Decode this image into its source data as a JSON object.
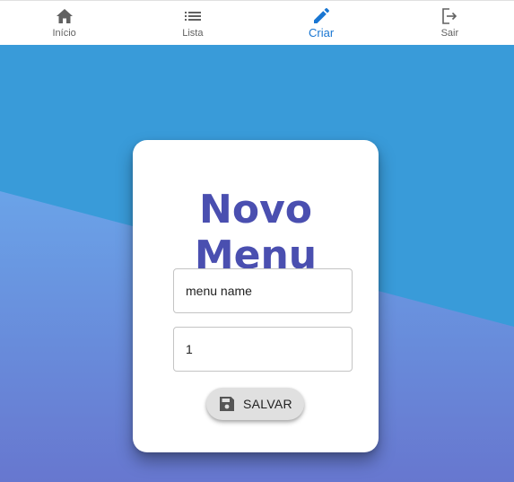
{
  "nav": {
    "items": [
      {
        "label": "Início",
        "icon": "home-icon"
      },
      {
        "label": "Lista",
        "icon": "list-icon"
      },
      {
        "label": "Criar",
        "icon": "pencil-icon",
        "active": true
      },
      {
        "label": "Sair",
        "icon": "logout-icon"
      }
    ]
  },
  "form": {
    "title": "Novo Menu",
    "name_value": "menu name",
    "quantity_value": "1",
    "save_label": "SALVAR",
    "save_icon": "save-icon"
  },
  "colors": {
    "background_top": "#3a9bd9",
    "background_bottom": "#6a7bd1",
    "title": "#4a4fb0",
    "active_nav": "#1976d2",
    "button": "#e0e0e0"
  }
}
